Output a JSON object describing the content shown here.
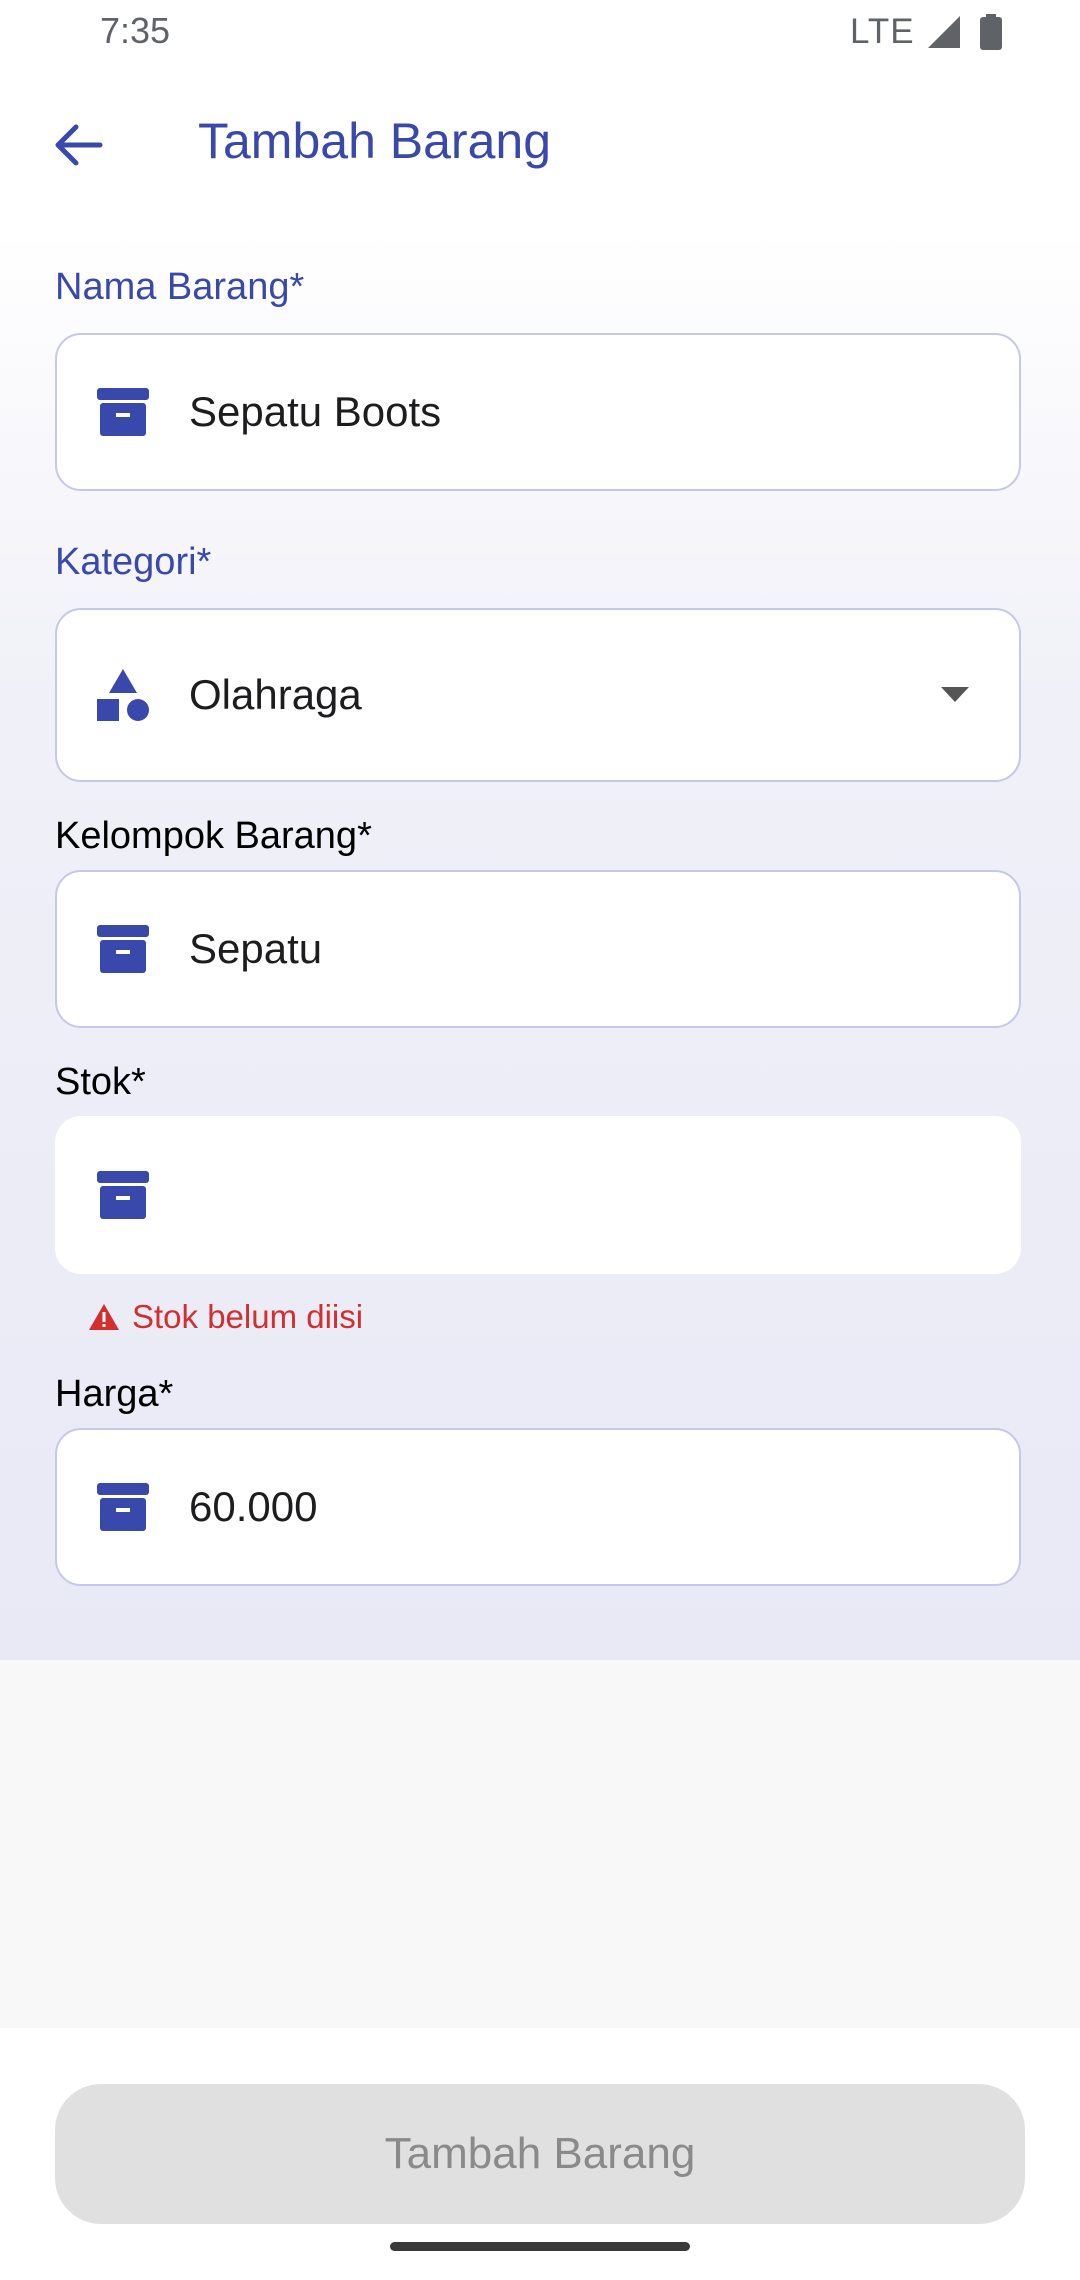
{
  "status_bar": {
    "time": "7:35",
    "network": "LTE"
  },
  "header": {
    "title": "Tambah Barang",
    "back_icon": "arrow-left-icon"
  },
  "form": {
    "nama_barang": {
      "label": "Nama Barang*",
      "value": "Sepatu Boots",
      "icon": "archive-box-icon"
    },
    "kategori": {
      "label": "Kategori*",
      "value": "Olahraga",
      "icon": "shapes-icon"
    },
    "kelompok_barang": {
      "label": "Kelompok Barang*",
      "value": "Sepatu",
      "icon": "archive-box-icon"
    },
    "stok": {
      "label": "Stok*",
      "value": "",
      "icon": "archive-box-icon",
      "error": "Stok belum diisi"
    },
    "harga": {
      "label": "Harga*",
      "value": "60.000",
      "icon": "archive-box-icon"
    }
  },
  "submit_button": {
    "label": "Tambah Barang"
  },
  "colors": {
    "accent": "#3949ab",
    "error": "#d32f2f",
    "disabled_bg": "#e0e0e0",
    "disabled_text": "#8a8a8a"
  }
}
